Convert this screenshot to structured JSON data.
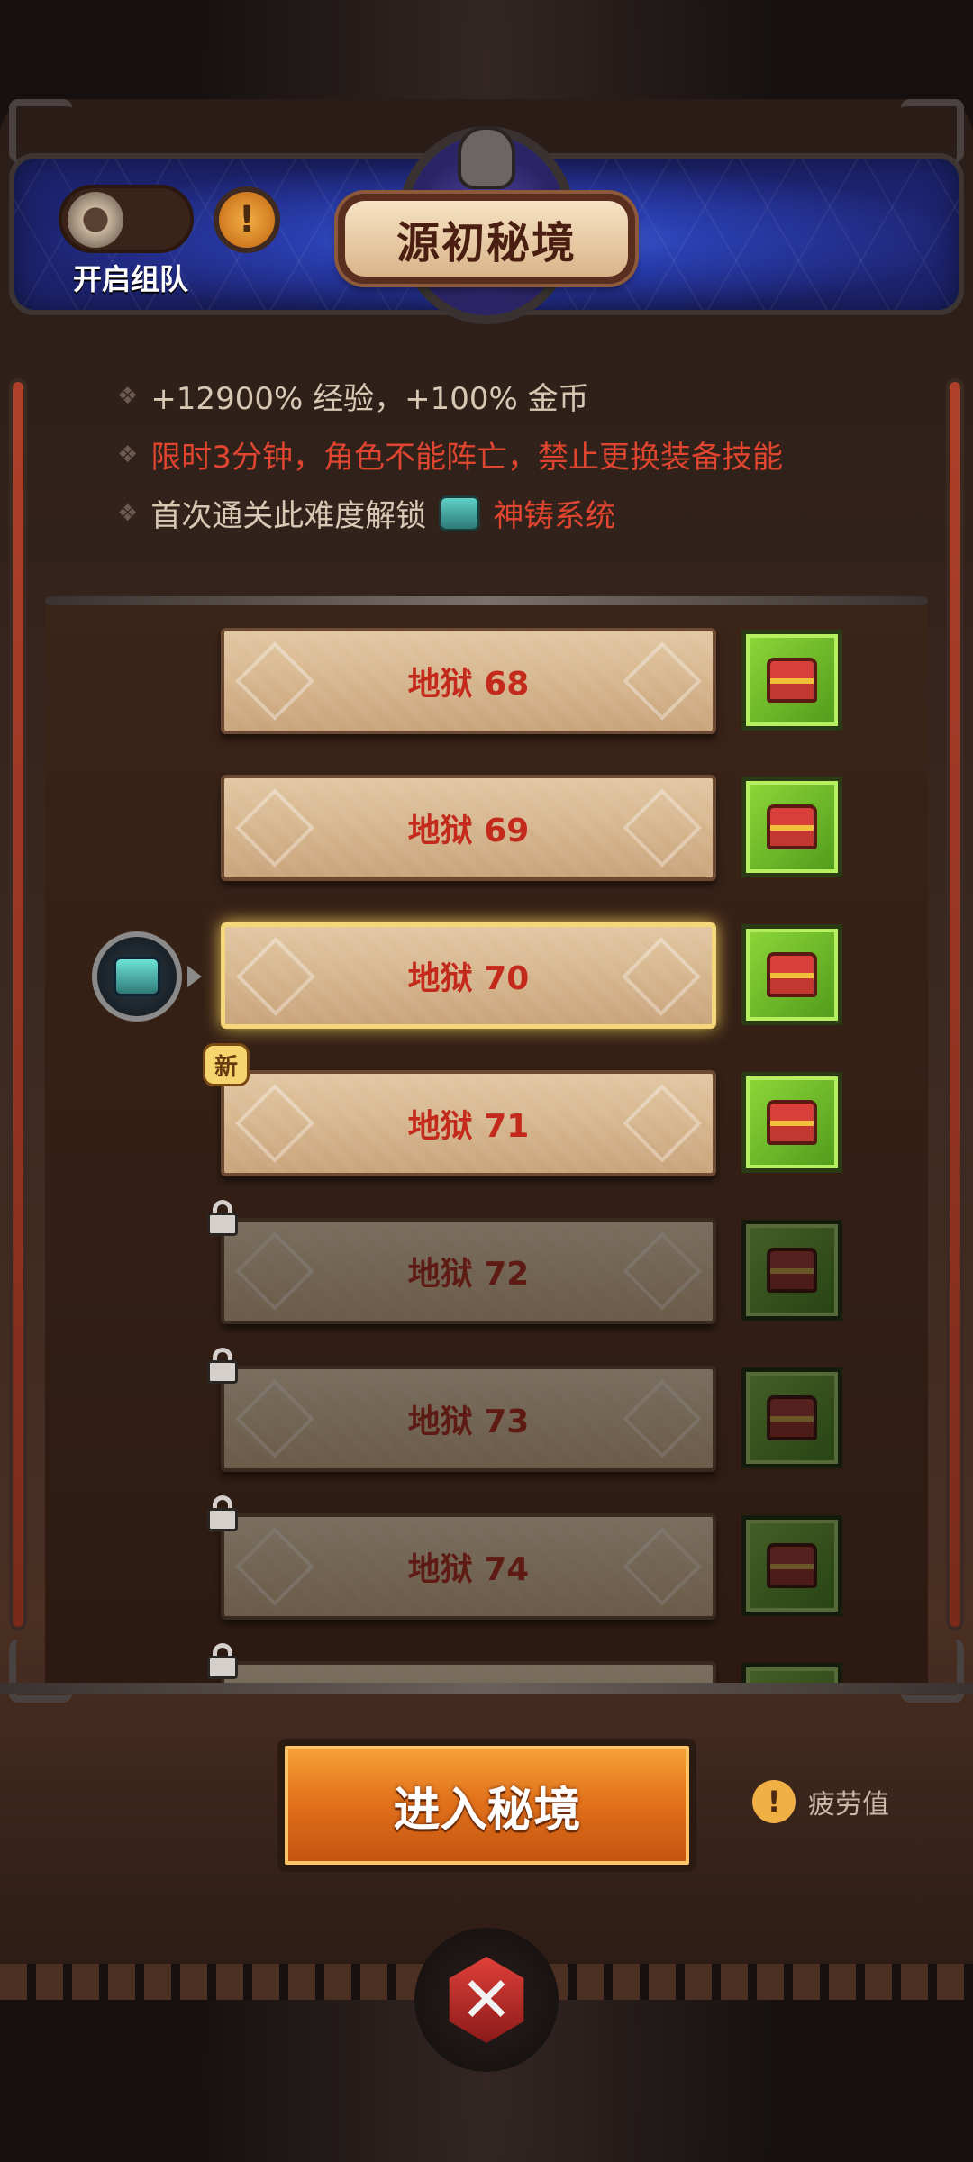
{
  "header": {
    "title": "源初秘境",
    "team_toggle_label": "开启组队",
    "warn_icon": "!"
  },
  "info": {
    "line1": "+12900% 经验，+100% 金币",
    "line2": "限时3分钟，角色不能阵亡，禁止更换装备技能",
    "line3_prefix": "首次通关此难度解锁",
    "line3_highlight": "神铸系统",
    "bullet": "❖"
  },
  "levels": [
    {
      "label": "地狱 68",
      "state": "unlocked"
    },
    {
      "label": "地狱 69",
      "state": "unlocked"
    },
    {
      "label": "地狱 70",
      "state": "selected"
    },
    {
      "label": "地狱 71",
      "state": "new",
      "badge": "新"
    },
    {
      "label": "地狱 72",
      "state": "locked"
    },
    {
      "label": "地狱 73",
      "state": "locked"
    },
    {
      "label": "地狱 74",
      "state": "locked"
    }
  ],
  "footer": {
    "enter_label": "进入秘境",
    "fatigue_label": "疲劳值",
    "fatigue_icon": "!",
    "close_icon": "✕"
  },
  "colors": {
    "accent_orange": "#e3731c",
    "danger_red": "#e0452f",
    "chest_green": "#8ed83a",
    "header_blue": "#2a3eb0"
  }
}
